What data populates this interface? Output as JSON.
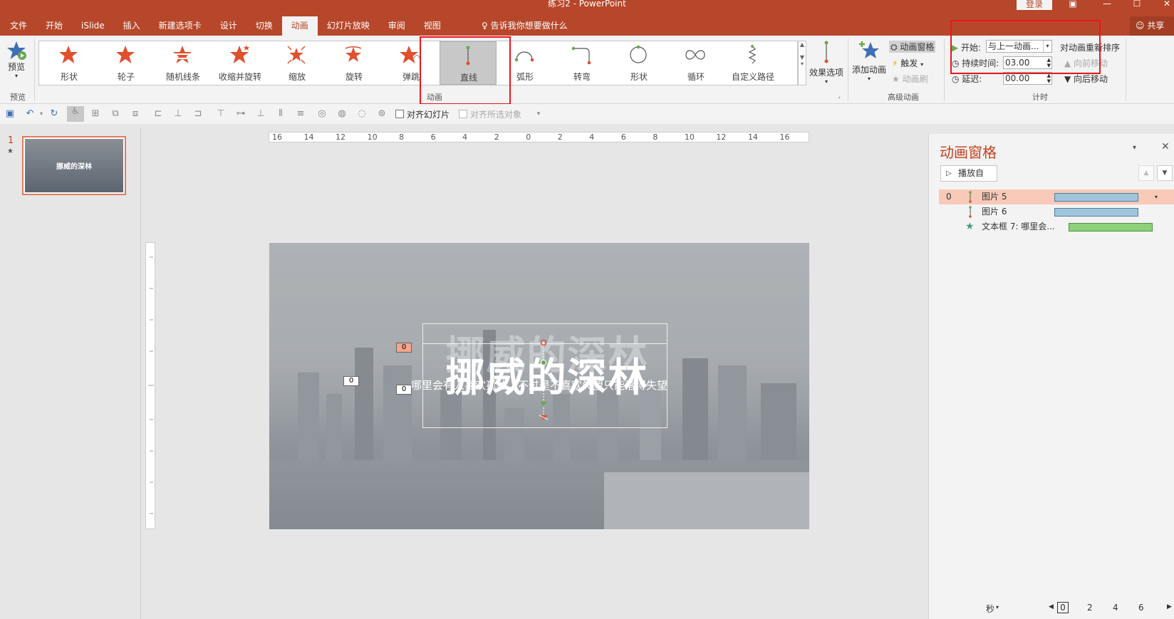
{
  "window": {
    "title": "练习2 - PowerPoint",
    "login": "登录",
    "share": "共享",
    "tell_me": "告诉我你想要做什么"
  },
  "tabs": [
    "文件",
    "开始",
    "iSlide",
    "插入",
    "新建选项卡",
    "设计",
    "切换",
    "动画",
    "幻灯片放映",
    "审阅",
    "视图"
  ],
  "active_tab": "动画",
  "ribbon": {
    "preview_label": "预览",
    "preview_group": "预览",
    "animation_group": "动画",
    "gallery": [
      {
        "label": "形状",
        "icon": "star-icon"
      },
      {
        "label": "轮子",
        "icon": "star-icon"
      },
      {
        "label": "随机线条",
        "icon": "star-lines-icon"
      },
      {
        "label": "收缩并旋转",
        "icon": "star-spin-icon"
      },
      {
        "label": "缩放",
        "icon": "star-zoom-icon"
      },
      {
        "label": "旋转",
        "icon": "star-rotate-icon"
      },
      {
        "label": "弹跳",
        "icon": "star-bounce-icon"
      },
      {
        "label": "直线",
        "icon": "line-path-icon"
      },
      {
        "label": "弧形",
        "icon": "arc-path-icon"
      },
      {
        "label": "转弯",
        "icon": "turn-path-icon"
      },
      {
        "label": "形状",
        "icon": "circle-path-icon"
      },
      {
        "label": "循环",
        "icon": "loop-path-icon"
      },
      {
        "label": "自定义路径",
        "icon": "custom-path-icon"
      }
    ],
    "selected_gallery": "直线",
    "effect_options": "效果选项",
    "add_animation": "添加动画",
    "animation_pane": "动画窗格",
    "trigger": "触发",
    "animation_painter": "动画刷",
    "advanced_group": "高级动画",
    "start_label": "开始:",
    "start_value": "与上一动画...",
    "duration_label": "持续时间:",
    "duration_value": "03.00",
    "delay_label": "延迟:",
    "delay_value": "00.00",
    "reorder": "对动画重新排序",
    "move_earlier": "向前移动",
    "move_later": "向后移动",
    "timing_group": "计时"
  },
  "qat": {
    "align_slide": "对齐幻灯片",
    "align_selected": "对齐所选对象"
  },
  "thumbnail": {
    "number": "1",
    "title": "挪威的深林"
  },
  "ruler": {
    "labels": [
      "16",
      "14",
      "12",
      "10",
      "8",
      "6",
      "4",
      "2",
      "0",
      "2",
      "4",
      "6",
      "8",
      "10",
      "12",
      "14",
      "16"
    ]
  },
  "slide": {
    "title": "挪威的深林",
    "subtitle": "哪里会有人喜欢孤独，不过是不喜欢失望只能落得失望",
    "tags": [
      "0",
      "0",
      "0"
    ]
  },
  "anim_pane": {
    "title": "动画窗格",
    "play_button": "播放自",
    "items": [
      {
        "index": "0",
        "name": "图片 5",
        "icon": "line-path-icon",
        "color": "#9fc5dd"
      },
      {
        "index": "",
        "name": "图片 6",
        "icon": "line-path-icon",
        "color": "#9fc5dd"
      },
      {
        "index": "",
        "name": "文本框 7: 哪里会...",
        "icon": "star-icon",
        "color": "#8bd27a"
      }
    ],
    "seconds_label": "秒",
    "timeline": [
      "0",
      "2",
      "4",
      "6"
    ]
  }
}
